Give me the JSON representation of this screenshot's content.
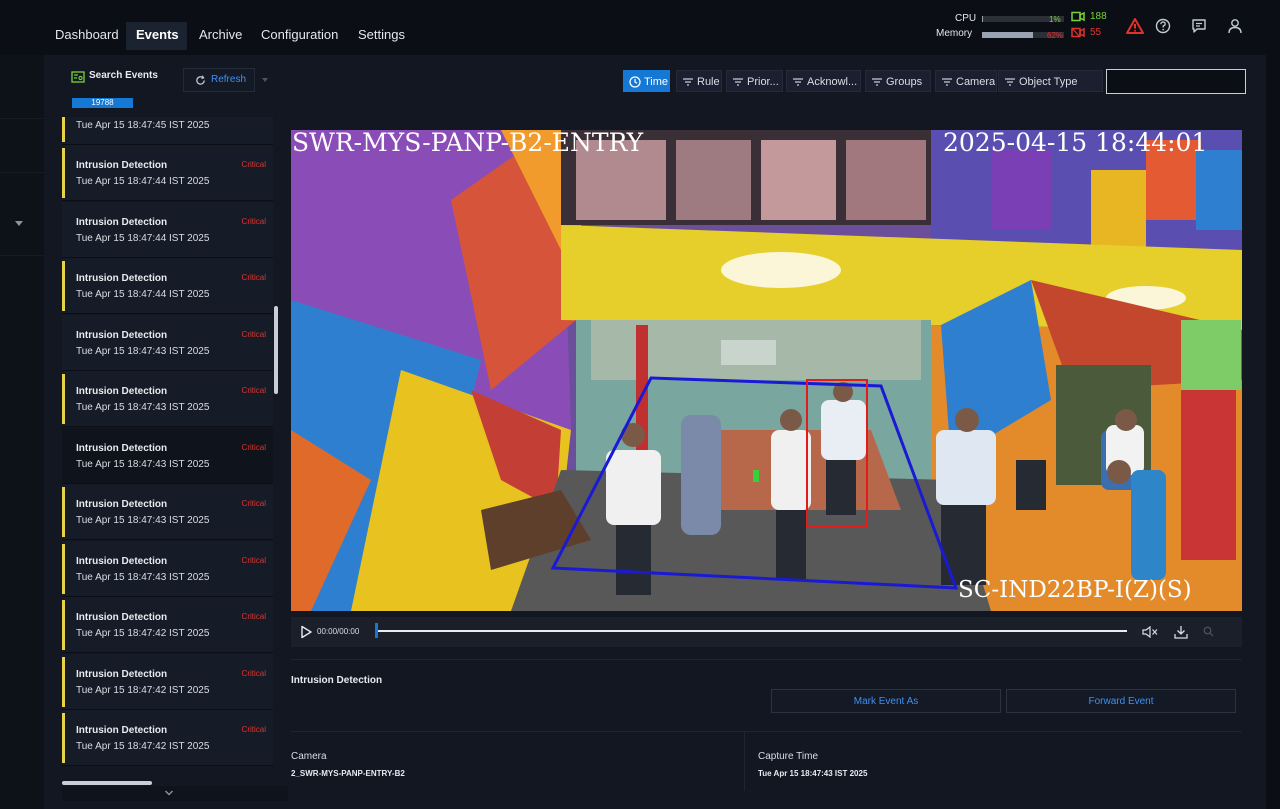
{
  "nav": {
    "tabs": [
      {
        "label": "Dashboard"
      },
      {
        "label": "Events"
      },
      {
        "label": "Archive"
      },
      {
        "label": "Configuration"
      },
      {
        "label": "Settings"
      }
    ],
    "active": 1
  },
  "system": {
    "cpu_label": "CPU",
    "cpu_value": "1%",
    "cpu_fraction": 0.01,
    "memory_label": "Memory",
    "memory_value": "62%",
    "memory_fraction": 0.62,
    "cameras_online": "188",
    "cameras_offline": "55",
    "colors": {
      "ok": "#7bd337",
      "alert": "#e0322d"
    }
  },
  "toolbar": {
    "search_events_label": "Search Events",
    "refresh_label": "Refresh",
    "event_count": "19788",
    "filters": [
      {
        "label": "Time",
        "active": true
      },
      {
        "label": "Rule",
        "active": false
      },
      {
        "label": "Prior...",
        "active": false
      },
      {
        "label": "Acknowl...",
        "active": false
      },
      {
        "label": "Groups",
        "active": false
      },
      {
        "label": "Camera",
        "active": false
      },
      {
        "label": "Object Type",
        "active": false
      }
    ],
    "search_value": ""
  },
  "events": {
    "first_partial_time": "Tue Apr 15 18:47:45 IST 2025",
    "items": [
      {
        "title": "Intrusion Detection",
        "time": "Tue Apr 15 18:47:44 IST 2025",
        "priority": "Critical",
        "marked": true
      },
      {
        "title": "Intrusion Detection",
        "time": "Tue Apr 15 18:47:44 IST 2025",
        "priority": "Critical",
        "marked": false
      },
      {
        "title": "Intrusion Detection",
        "time": "Tue Apr 15 18:47:44 IST 2025",
        "priority": "Critical",
        "marked": true
      },
      {
        "title": "Intrusion Detection",
        "time": "Tue Apr 15 18:47:43 IST 2025",
        "priority": "Critical",
        "marked": false
      },
      {
        "title": "Intrusion Detection",
        "time": "Tue Apr 15 18:47:43 IST 2025",
        "priority": "Critical",
        "marked": true
      },
      {
        "title": "Intrusion Detection",
        "time": "Tue Apr 15 18:47:43 IST 2025",
        "priority": "Critical",
        "marked": false,
        "selected": true
      },
      {
        "title": "Intrusion Detection",
        "time": "Tue Apr 15 18:47:43 IST 2025",
        "priority": "Critical",
        "marked": true
      },
      {
        "title": "Intrusion Detection",
        "time": "Tue Apr 15 18:47:43 IST 2025",
        "priority": "Critical",
        "marked": true
      },
      {
        "title": "Intrusion Detection",
        "time": "Tue Apr 15 18:47:42 IST 2025",
        "priority": "Critical",
        "marked": true
      },
      {
        "title": "Intrusion Detection",
        "time": "Tue Apr 15 18:47:42 IST 2025",
        "priority": "Critical",
        "marked": true
      },
      {
        "title": "Intrusion Detection",
        "time": "Tue Apr 15 18:47:42 IST 2025",
        "priority": "Critical",
        "marked": true
      }
    ]
  },
  "video": {
    "overlay_camera": "SWR-MYS-PANP-B2-ENTRY",
    "overlay_timestamp": "2025-04-15 18:44:01",
    "overlay_device": "SC-IND22BP-I(Z)(S)",
    "playback_time": "00:00/00:00",
    "progress_fraction": 0.0,
    "zone_color": "#1a1ad6",
    "detection_color": "#e31b1b",
    "icons": [
      "play-icon",
      "mute-icon",
      "download-icon",
      "zoom-icon"
    ]
  },
  "detail": {
    "event_title": "Intrusion Detection",
    "mark_event_label": "Mark Event As",
    "forward_event_label": "Forward Event",
    "camera_label": "Camera",
    "camera_value": "2_SWR-MYS-PANP-ENTRY-B2",
    "capture_time_label": "Capture Time",
    "capture_time_value": "Tue Apr 15 18:47:43 IST 2025"
  }
}
